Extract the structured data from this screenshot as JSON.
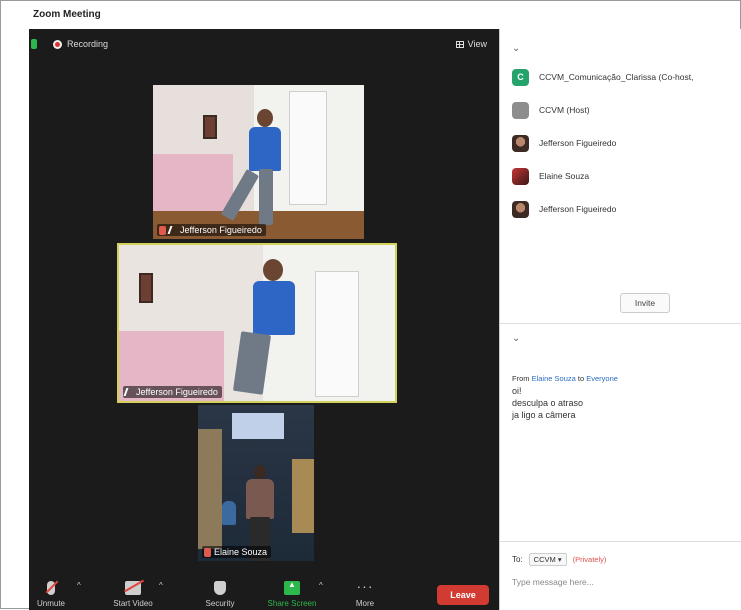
{
  "window": {
    "title": "Zoom Meeting"
  },
  "topbar": {
    "recording_label": "Recording",
    "view_label": "View"
  },
  "videos": [
    {
      "name": "Jefferson Figueiredo"
    },
    {
      "name": "Jefferson Figueiredo"
    },
    {
      "name": "Elaine Souza"
    }
  ],
  "toolbar": {
    "unmute": "Unmute",
    "start_video": "Start Video",
    "security": "Security",
    "share_screen": "Share Screen",
    "more": "More",
    "leave": "Leave",
    "more_dots": "···"
  },
  "participants": {
    "list": [
      {
        "avatar_letter": "C",
        "name": "CCVM_Comunicação_Clarissa (Co-host,"
      },
      {
        "avatar_letter": "",
        "name": "CCVM (Host)"
      },
      {
        "avatar_letter": "",
        "name": "Jefferson Figueiredo"
      },
      {
        "avatar_letter": "",
        "name": "Elaine Souza"
      },
      {
        "avatar_letter": "",
        "name": "Jefferson Figueiredo"
      }
    ],
    "invite_label": "Invite"
  },
  "chat": {
    "from_prefix": "From",
    "sender": "Elaine Souza",
    "to_word": "to",
    "recipient": "Everyone",
    "messages": [
      "oi!",
      "desculpa o atraso",
      "ja ligo a câmera"
    ],
    "to_label": "To:",
    "to_value": "CCVM ▾",
    "privately": "(Privately)",
    "input_placeholder": "Type message here..."
  },
  "colors": {
    "leave": "#d13b31",
    "share": "#2db84d",
    "active_speaker_border": "#d2d25a"
  }
}
